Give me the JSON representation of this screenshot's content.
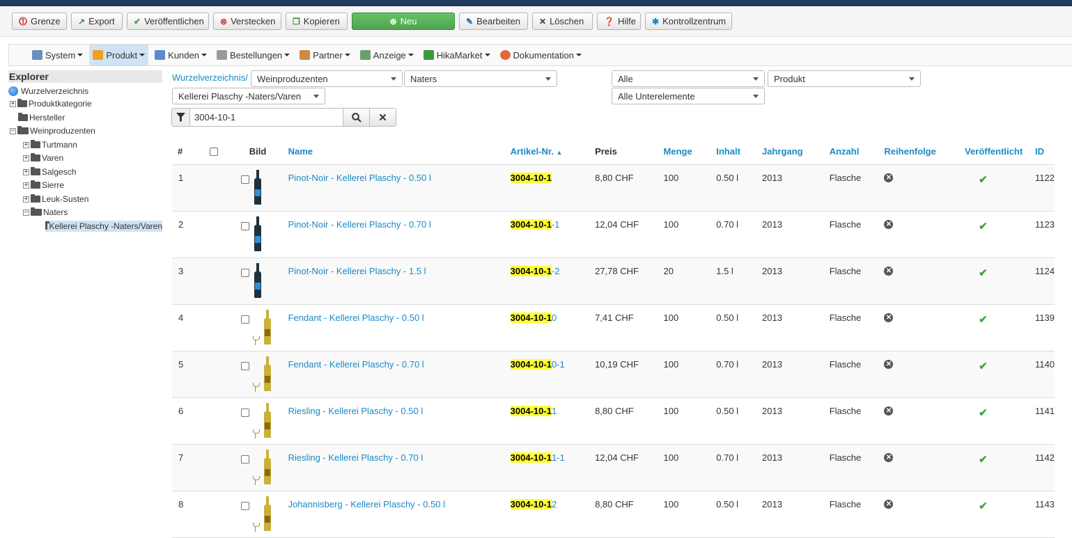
{
  "toolbar": {
    "limit": "Grenze",
    "export": "Export",
    "publish": "Veröffentlichen",
    "hide": "Verstecken",
    "copy": "Kopieren",
    "new": "Neu",
    "edit": "Bearbeiten",
    "delete": "Löschen",
    "help": "Hilfe",
    "control": "Kontrollzentrum"
  },
  "menu": {
    "items": [
      "System",
      "Produkt",
      "Kunden",
      "Bestellungen",
      "Partner",
      "Anzeige",
      "HikaMarket",
      "Dokumentation"
    ],
    "active": "Produkt"
  },
  "explorer": {
    "title": "Explorer",
    "root": "Wurzelverzeichnis",
    "nodes": [
      "Produktkategorie",
      "Hersteller",
      "Weinproduzenten",
      "Turtmann",
      "Varen",
      "Salgesch",
      "Sierre",
      "Leuk-Susten",
      "Naters",
      "Kellerei Plaschy -Naters/Varen"
    ]
  },
  "filters": {
    "breadcrumb": "Wurzelverzeichnis/",
    "cat1": "Weinproduzenten",
    "cat2": "Naters",
    "cat3": "Kellerei Plaschy -Naters/Varen",
    "status": "Alle",
    "type": "Produkt",
    "children": "Alle Unterelemente",
    "search_value": "3004-10-1"
  },
  "table": {
    "headers": {
      "num": "#",
      "image": "Bild",
      "name": "Name",
      "sku": "Artikel-Nr.",
      "price": "Preis",
      "qty": "Menge",
      "content": "Inhalt",
      "vintage": "Jahrgang",
      "count": "Anzahl",
      "order": "Reihenfolge",
      "published": "Veröffentlicht",
      "id": "ID"
    },
    "rows": [
      {
        "num": "1",
        "name": "Pinot-Noir - Kellerei Plaschy - 0.50 l",
        "sku_match": "3004-10-1",
        "sku_rest": "",
        "price": "8,80 CHF",
        "qty": "100",
        "content": "0.50 l",
        "vintage": "2013",
        "count": "Flasche",
        "id": "1122"
      },
      {
        "num": "2",
        "name": "Pinot-Noir - Kellerei Plaschy - 0.70 l",
        "sku_match": "3004-10-1",
        "sku_rest": "-1",
        "price": "12,04 CHF",
        "qty": "100",
        "content": "0.70 l",
        "vintage": "2013",
        "count": "Flasche",
        "id": "1123"
      },
      {
        "num": "3",
        "name": "Pinot-Noir - Kellerei Plaschy - 1.5 l",
        "sku_match": "3004-10-1",
        "sku_rest": "-2",
        "price": "27,78 CHF",
        "qty": "20",
        "content": "1.5 l",
        "vintage": "2013",
        "count": "Flasche",
        "id": "1124"
      },
      {
        "num": "4",
        "name": "Fendant - Kellerei Plaschy - 0.50 l",
        "sku_match": "3004-10-1",
        "sku_rest": "0",
        "price": "7,41 CHF",
        "qty": "100",
        "content": "0.50 l",
        "vintage": "2013",
        "count": "Flasche",
        "id": "1139"
      },
      {
        "num": "5",
        "name": "Fendant - Kellerei Plaschy - 0.70 l",
        "sku_match": "3004-10-1",
        "sku_rest": "0-1",
        "price": "10,19 CHF",
        "qty": "100",
        "content": "0.70 l",
        "vintage": "2013",
        "count": "Flasche",
        "id": "1140"
      },
      {
        "num": "6",
        "name": "Riesling - Kellerei Plaschy - 0.50 l",
        "sku_match": "3004-10-1",
        "sku_rest": "1",
        "price": "8,80 CHF",
        "qty": "100",
        "content": "0.50 l",
        "vintage": "2013",
        "count": "Flasche",
        "id": "1141"
      },
      {
        "num": "7",
        "name": "Riesling - Kellerei Plaschy - 0.70 l",
        "sku_match": "3004-10-1",
        "sku_rest": "1-1",
        "price": "12,04 CHF",
        "qty": "100",
        "content": "0.70 l",
        "vintage": "2013",
        "count": "Flasche",
        "id": "1142"
      },
      {
        "num": "8",
        "name": "Johannisberg - Kellerei Plaschy - 0.50 l",
        "sku_match": "3004-10-1",
        "sku_rest": "2",
        "price": "8,80 CHF",
        "qty": "100",
        "content": "0.50 l",
        "vintage": "2013",
        "count": "Flasche",
        "id": "1143"
      }
    ]
  },
  "icons": {
    "bottle_kinds": [
      "red",
      "red",
      "red",
      "white",
      "white",
      "white",
      "white",
      "white"
    ]
  }
}
